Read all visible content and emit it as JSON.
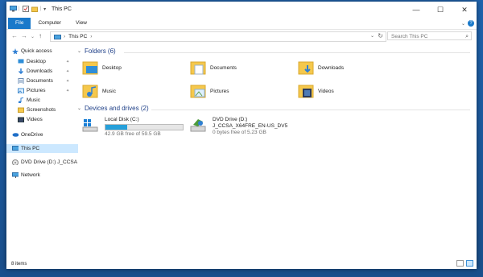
{
  "window": {
    "title": "This PC"
  },
  "ribbon": {
    "tabs": [
      "File",
      "Computer",
      "View"
    ],
    "help": "?"
  },
  "window_controls": {
    "minimize": "—",
    "maximize": "☐",
    "close": "✕"
  },
  "address": {
    "root": "This PC",
    "search_placeholder": "Search This PC"
  },
  "sidebar": {
    "items": [
      {
        "label": "Quick access"
      },
      {
        "label": "Desktop"
      },
      {
        "label": "Downloads"
      },
      {
        "label": "Documents"
      },
      {
        "label": "Pictures"
      },
      {
        "label": "Music"
      },
      {
        "label": "Screenshots"
      },
      {
        "label": "Videos"
      },
      {
        "label": "OneDrive"
      },
      {
        "label": "This PC"
      },
      {
        "label": "DVD Drive (D:) J_CCSA"
      },
      {
        "label": "Network"
      }
    ]
  },
  "folders_group": {
    "label": "Folders (6)"
  },
  "folders": [
    {
      "name": "Desktop"
    },
    {
      "name": "Documents"
    },
    {
      "name": "Downloads"
    },
    {
      "name": "Music"
    },
    {
      "name": "Pictures"
    },
    {
      "name": "Videos"
    }
  ],
  "devices_group": {
    "label": "Devices and drives (2)"
  },
  "drives": [
    {
      "name": "Local Disk (C:)",
      "free": "42.9 GB free of 59.5 GB",
      "used_fraction": 0.28
    },
    {
      "name": "DVD Drive (D:)",
      "name2": "J_CCSA_X64FRE_EN-US_DV5",
      "free": "0 bytes free of 5.23 GB"
    }
  ],
  "status": {
    "items": "8 items"
  },
  "colors": {
    "accent": "#1979ca",
    "folder": "#f5c84c",
    "selected": "#cce8ff",
    "bar": "#26a0da"
  }
}
